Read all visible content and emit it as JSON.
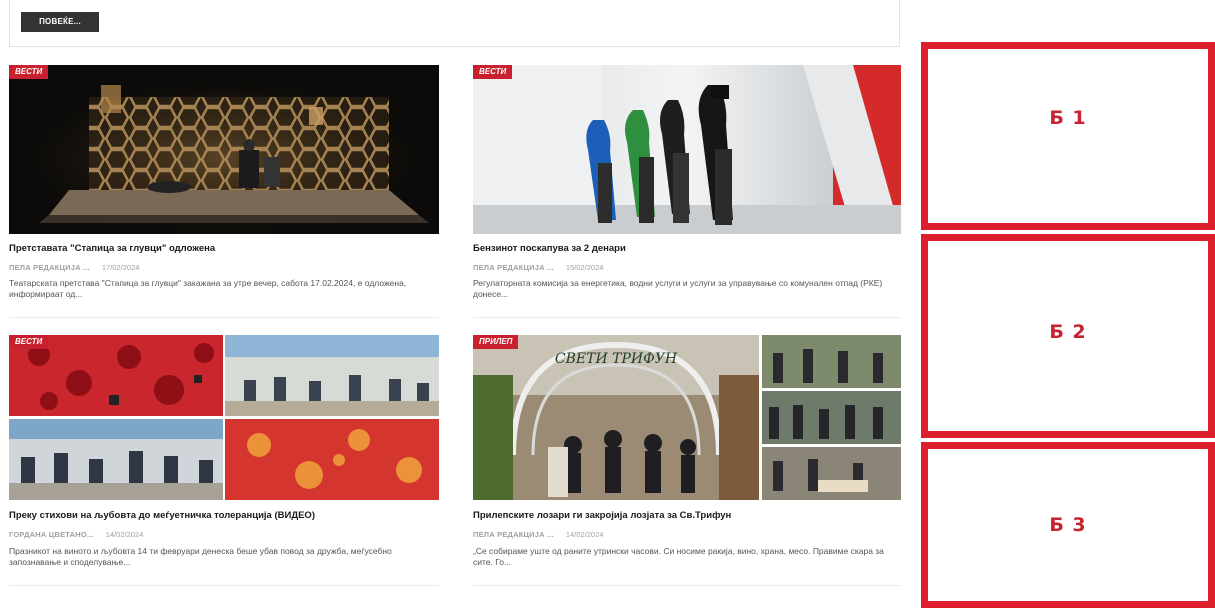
{
  "more_button": "ПОВЕЌЕ...",
  "articles": [
    {
      "category": "ВЕСТИ",
      "title": "Претставата \"Стапица за глувци\" одложена",
      "author": "ПЕЛА РЕДАКЦИЈА ...",
      "date": "17/02/2024",
      "excerpt": "Театарската претстава \"Стапица за глувци\" закажана за утре вечер, сабота 17.02.2024, е одложена, информираат од..."
    },
    {
      "category": "ВЕСТИ",
      "title": "Бензинот поскапува за 2 денари",
      "author": "ПЕЛА РЕДАКЦИЈА ...",
      "date": "15/02/2024",
      "excerpt": "Регулаторната комисија за енергетика, водни услуги и услуги за управување со комунален отпад (РКЕ) донесе..."
    },
    {
      "category": "ВЕСТИ",
      "title": "Преку стихови на љубовта до меѓуетничка толеранција (ВИДЕО)",
      "author": "ГОРДАНА ЦВЕТАНО...",
      "date": "14/02/2024",
      "excerpt": "Празникот на виното и љубовта 14 ти февруари денеска беше убав повод за дружба, меѓусебно запознавање и споделување..."
    },
    {
      "category": "ПРИЛЕП",
      "title": "Прилепските лозари ги закројија лозјата за Св.Трифун",
      "author": "ПЕЛА РЕДАКЦИЈА ...",
      "date": "14/02/2024",
      "excerpt": "„Се собираме уште од раните утрински часови. Си носиме ракија, вино, храна, месо. Правиме скара за сите. Го..."
    }
  ],
  "image_sign_text": "СВЕТИ ТРИФУН",
  "ads": [
    "Б 1",
    "Б 2",
    "Б 3"
  ]
}
